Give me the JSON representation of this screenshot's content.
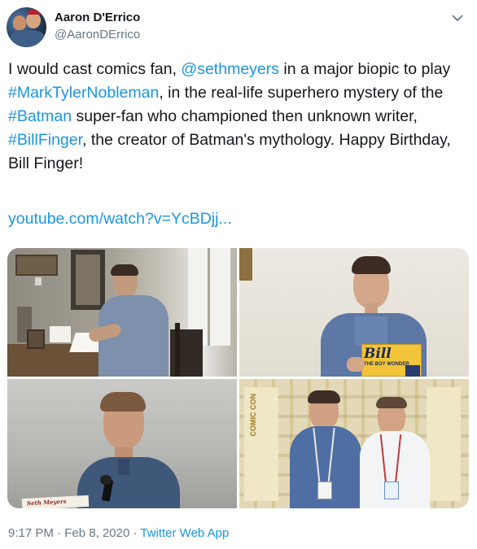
{
  "author": {
    "display_name": "Aaron D'Errico",
    "handle": "@AaronDErrico"
  },
  "tweet": {
    "text_parts": [
      {
        "text": "I would cast comics fan, ",
        "link": false
      },
      {
        "text": "@sethmeyers",
        "link": true
      },
      {
        "text": " in a major biopic to play ",
        "link": false
      },
      {
        "text": "#MarkTylerNobleman",
        "link": true
      },
      {
        "text": ", in the real-life superhero mystery of the ",
        "link": false
      },
      {
        "text": "#Batman",
        "link": true
      },
      {
        "text": " super-fan who championed then unknown writer, ",
        "link": false
      },
      {
        "text": "#BillFinger",
        "link": true
      },
      {
        "text": ", the creator of Batman's mythology. Happy Birthday, Bill Finger!",
        "link": false
      }
    ],
    "url": "youtube.com/watch?v=YcBDjj..."
  },
  "media": {
    "book_title": "Bill",
    "book_subtitle": "THE BOY WONDER",
    "card_text": "Seth Meyers",
    "banner_text": "COMIC CON"
  },
  "footer": {
    "time": "9:17 PM",
    "separator": " · ",
    "date": "Feb 8, 2020",
    "app": "Twitter Web App"
  },
  "colors": {
    "link": "#1b95e0",
    "secondary_text": "#657786",
    "primary_text": "#14171a"
  },
  "icons": {
    "caret": "chevron-down-icon"
  }
}
